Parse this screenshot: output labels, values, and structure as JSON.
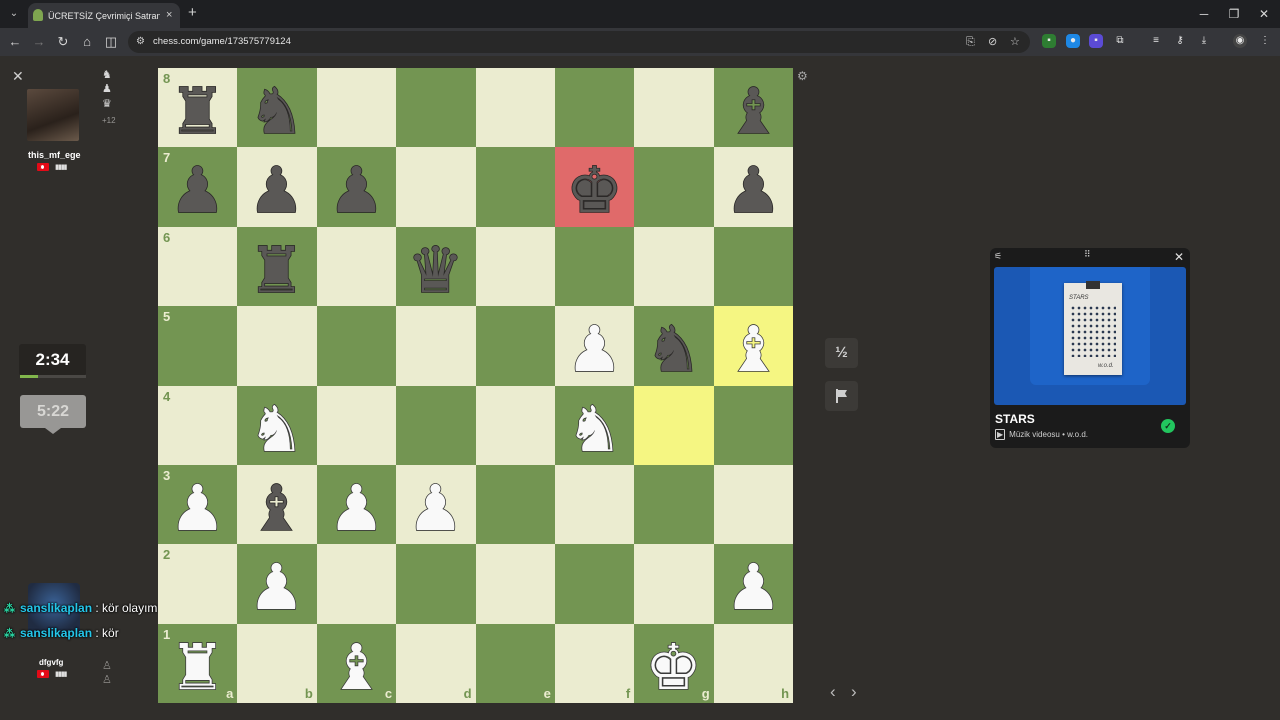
{
  "browser": {
    "tab_title": "ÜCRETSİZ Çevrimiçi Satranç Oy",
    "tab_close": "×",
    "new_tab": "+",
    "url": "chess.com/game/173575779124"
  },
  "left_panel": {
    "close": "✕",
    "top_player": {
      "name": "this_mf_ege",
      "bars": "▮▮▮▮"
    },
    "captured_score": "+12",
    "clock_top": "2:34",
    "clock_top_progress": 0.27,
    "clock_bottom": "5:22",
    "bottom_player": {
      "name": "dfgvfg",
      "bars": "▮▮▮▮"
    }
  },
  "chat": [
    {
      "user": "sanslikaplan",
      "sep": " :",
      "message": " kör olayım"
    },
    {
      "user": "sanslikaplan",
      "sep": " :",
      "message": " kör"
    }
  ],
  "board": {
    "ranks": [
      "8",
      "7",
      "6",
      "5",
      "4",
      "3",
      "2",
      "1"
    ],
    "files": [
      "a",
      "b",
      "c",
      "d",
      "e",
      "f",
      "g",
      "h"
    ],
    "highlights": {
      "g4": "last-move",
      "h5": "last-move",
      "f7": "check"
    },
    "pieces": {
      "a8": "bR",
      "b8": "bN",
      "h8": "bB",
      "a7": "bP",
      "b7": "bP",
      "c7": "bP",
      "f7": "bK",
      "h7": "bP",
      "b6": "bR",
      "d6": "bQ",
      "f5": "wP",
      "g5": "bN",
      "h5": "wB",
      "b4": "wN",
      "f4": "wN",
      "a3": "wP",
      "b3": "bB",
      "c3": "wP",
      "d3": "wP",
      "b2": "wP",
      "h2": "wP",
      "a1": "wR",
      "c1": "wB",
      "g1": "wK"
    }
  },
  "controls": {
    "draw": "½",
    "resign_icon": "flag-icon",
    "prev": "‹",
    "next": "›"
  },
  "mini_player": {
    "title": "STARS",
    "subtitle": "Müzik videosu • w.o.d.",
    "poster_title": "STARS",
    "poster_signature": "w.o.d."
  }
}
